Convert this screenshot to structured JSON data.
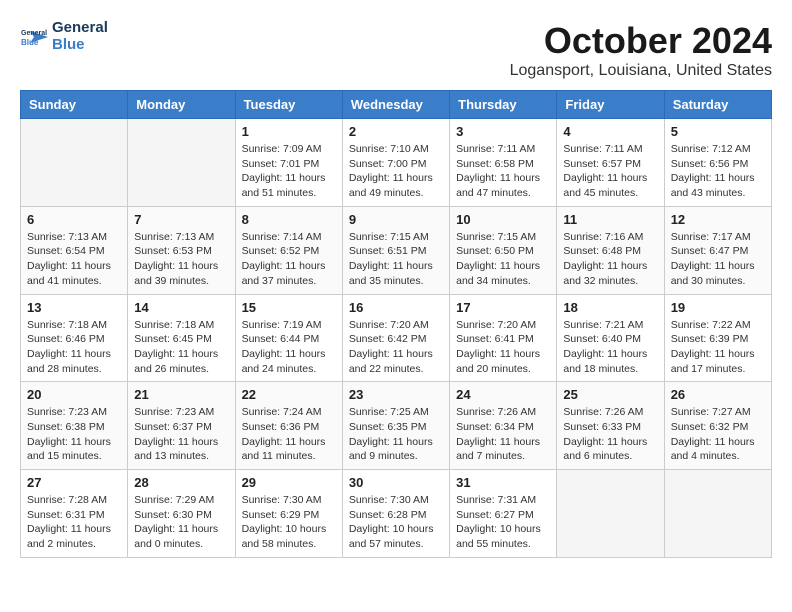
{
  "logo": {
    "line1": "General",
    "line2": "Blue"
  },
  "title": "October 2024",
  "location": "Logansport, Louisiana, United States",
  "headers": [
    "Sunday",
    "Monday",
    "Tuesday",
    "Wednesday",
    "Thursday",
    "Friday",
    "Saturday"
  ],
  "weeks": [
    [
      {
        "day": "",
        "info": ""
      },
      {
        "day": "",
        "info": ""
      },
      {
        "day": "1",
        "info": "Sunrise: 7:09 AM\nSunset: 7:01 PM\nDaylight: 11 hours and 51 minutes."
      },
      {
        "day": "2",
        "info": "Sunrise: 7:10 AM\nSunset: 7:00 PM\nDaylight: 11 hours and 49 minutes."
      },
      {
        "day": "3",
        "info": "Sunrise: 7:11 AM\nSunset: 6:58 PM\nDaylight: 11 hours and 47 minutes."
      },
      {
        "day": "4",
        "info": "Sunrise: 7:11 AM\nSunset: 6:57 PM\nDaylight: 11 hours and 45 minutes."
      },
      {
        "day": "5",
        "info": "Sunrise: 7:12 AM\nSunset: 6:56 PM\nDaylight: 11 hours and 43 minutes."
      }
    ],
    [
      {
        "day": "6",
        "info": "Sunrise: 7:13 AM\nSunset: 6:54 PM\nDaylight: 11 hours and 41 minutes."
      },
      {
        "day": "7",
        "info": "Sunrise: 7:13 AM\nSunset: 6:53 PM\nDaylight: 11 hours and 39 minutes."
      },
      {
        "day": "8",
        "info": "Sunrise: 7:14 AM\nSunset: 6:52 PM\nDaylight: 11 hours and 37 minutes."
      },
      {
        "day": "9",
        "info": "Sunrise: 7:15 AM\nSunset: 6:51 PM\nDaylight: 11 hours and 35 minutes."
      },
      {
        "day": "10",
        "info": "Sunrise: 7:15 AM\nSunset: 6:50 PM\nDaylight: 11 hours and 34 minutes."
      },
      {
        "day": "11",
        "info": "Sunrise: 7:16 AM\nSunset: 6:48 PM\nDaylight: 11 hours and 32 minutes."
      },
      {
        "day": "12",
        "info": "Sunrise: 7:17 AM\nSunset: 6:47 PM\nDaylight: 11 hours and 30 minutes."
      }
    ],
    [
      {
        "day": "13",
        "info": "Sunrise: 7:18 AM\nSunset: 6:46 PM\nDaylight: 11 hours and 28 minutes."
      },
      {
        "day": "14",
        "info": "Sunrise: 7:18 AM\nSunset: 6:45 PM\nDaylight: 11 hours and 26 minutes."
      },
      {
        "day": "15",
        "info": "Sunrise: 7:19 AM\nSunset: 6:44 PM\nDaylight: 11 hours and 24 minutes."
      },
      {
        "day": "16",
        "info": "Sunrise: 7:20 AM\nSunset: 6:42 PM\nDaylight: 11 hours and 22 minutes."
      },
      {
        "day": "17",
        "info": "Sunrise: 7:20 AM\nSunset: 6:41 PM\nDaylight: 11 hours and 20 minutes."
      },
      {
        "day": "18",
        "info": "Sunrise: 7:21 AM\nSunset: 6:40 PM\nDaylight: 11 hours and 18 minutes."
      },
      {
        "day": "19",
        "info": "Sunrise: 7:22 AM\nSunset: 6:39 PM\nDaylight: 11 hours and 17 minutes."
      }
    ],
    [
      {
        "day": "20",
        "info": "Sunrise: 7:23 AM\nSunset: 6:38 PM\nDaylight: 11 hours and 15 minutes."
      },
      {
        "day": "21",
        "info": "Sunrise: 7:23 AM\nSunset: 6:37 PM\nDaylight: 11 hours and 13 minutes."
      },
      {
        "day": "22",
        "info": "Sunrise: 7:24 AM\nSunset: 6:36 PM\nDaylight: 11 hours and 11 minutes."
      },
      {
        "day": "23",
        "info": "Sunrise: 7:25 AM\nSunset: 6:35 PM\nDaylight: 11 hours and 9 minutes."
      },
      {
        "day": "24",
        "info": "Sunrise: 7:26 AM\nSunset: 6:34 PM\nDaylight: 11 hours and 7 minutes."
      },
      {
        "day": "25",
        "info": "Sunrise: 7:26 AM\nSunset: 6:33 PM\nDaylight: 11 hours and 6 minutes."
      },
      {
        "day": "26",
        "info": "Sunrise: 7:27 AM\nSunset: 6:32 PM\nDaylight: 11 hours and 4 minutes."
      }
    ],
    [
      {
        "day": "27",
        "info": "Sunrise: 7:28 AM\nSunset: 6:31 PM\nDaylight: 11 hours and 2 minutes."
      },
      {
        "day": "28",
        "info": "Sunrise: 7:29 AM\nSunset: 6:30 PM\nDaylight: 11 hours and 0 minutes."
      },
      {
        "day": "29",
        "info": "Sunrise: 7:30 AM\nSunset: 6:29 PM\nDaylight: 10 hours and 58 minutes."
      },
      {
        "day": "30",
        "info": "Sunrise: 7:30 AM\nSunset: 6:28 PM\nDaylight: 10 hours and 57 minutes."
      },
      {
        "day": "31",
        "info": "Sunrise: 7:31 AM\nSunset: 6:27 PM\nDaylight: 10 hours and 55 minutes."
      },
      {
        "day": "",
        "info": ""
      },
      {
        "day": "",
        "info": ""
      }
    ]
  ]
}
